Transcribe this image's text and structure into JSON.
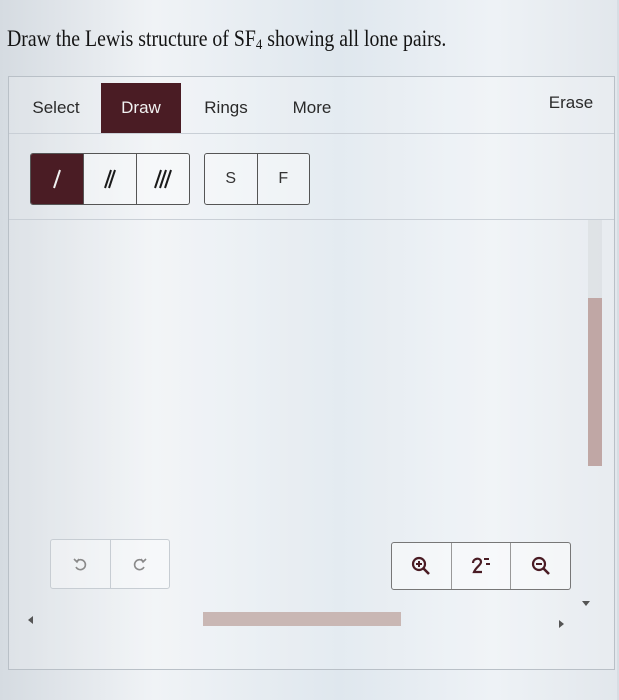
{
  "question": {
    "prefix": "Draw the Lewis structure of SF",
    "subscript": "4",
    "suffix": " showing all lone pairs."
  },
  "tabs": [
    {
      "label": "Select",
      "active": false
    },
    {
      "label": "Draw",
      "active": true
    },
    {
      "label": "Rings",
      "active": false
    },
    {
      "label": "More",
      "active": false
    }
  ],
  "erase_label": "Erase",
  "bond_tools": [
    {
      "name": "single-bond-icon",
      "active": true
    },
    {
      "name": "double-bond-icon",
      "active": false
    },
    {
      "name": "triple-bond-icon",
      "active": false
    }
  ],
  "atoms": [
    "S",
    "F"
  ],
  "history": [
    "undo-icon",
    "redo-icon"
  ],
  "zoom": [
    "zoom-in-icon",
    "zoom-reset-icon",
    "zoom-out-icon"
  ],
  "colors": {
    "accent": "#4a1c24",
    "scroll_thumb": "#c0a7a5"
  }
}
